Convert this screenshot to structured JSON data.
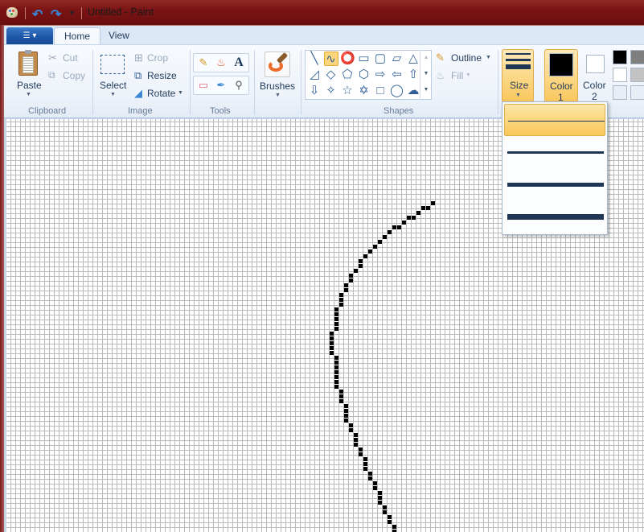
{
  "window": {
    "title": "Untitled - Paint",
    "qat": {
      "undo_icon": "undo-icon",
      "redo_icon": "redo-icon",
      "customize_icon": "chevron-down-icon"
    }
  },
  "tabs": {
    "file_menu_icon": "menu-icon",
    "items": [
      {
        "label": "Home",
        "active": true
      },
      {
        "label": "View",
        "active": false
      }
    ]
  },
  "ribbon": {
    "clipboard": {
      "group_label": "Clipboard",
      "paste": "Paste",
      "cut": "Cut",
      "copy": "Copy"
    },
    "image": {
      "group_label": "Image",
      "select": "Select",
      "crop": "Crop",
      "resize": "Resize",
      "rotate": "Rotate"
    },
    "tools": {
      "group_label": "Tools",
      "items": [
        "pencil",
        "fill",
        "text",
        "eraser",
        "color-picker",
        "magnifier"
      ],
      "text_glyph": "A"
    },
    "brushes": {
      "label": "Brushes"
    },
    "shapes": {
      "group_label": "Shapes",
      "gallery": [
        [
          "line",
          "curve",
          "oval",
          "rectangle",
          "rounded-rectangle",
          "polygon",
          "triangle"
        ],
        [
          "right-triangle",
          "diamond",
          "pentagon",
          "hexagon",
          "right-arrow",
          "left-arrow",
          "up-arrow"
        ],
        [
          "down-arrow",
          "four-point-star",
          "five-point-star",
          "six-point-star",
          "rounded-callout",
          "oval-callout",
          "cloud-callout"
        ]
      ],
      "selected": "curve",
      "outline": "Outline",
      "fill": "Fill"
    },
    "size": {
      "label": "Size"
    },
    "color1": {
      "label": "Color",
      "number": "1",
      "value": "#000000"
    },
    "color2": {
      "label": "Color",
      "number": "2",
      "value": "#ffffff"
    },
    "palette": [
      "#000000",
      "#7f7f7f",
      "#ffffff",
      "#c3c3c3",
      "#e8eef6",
      "#e8eef6"
    ]
  },
  "size_menu": {
    "options": [
      {
        "weight": 1,
        "selected": true
      },
      {
        "weight": 3,
        "selected": false
      },
      {
        "weight": 5,
        "selected": false
      },
      {
        "weight": 8,
        "selected": false
      }
    ],
    "line_color": "#1f3656"
  },
  "canvas": {
    "zoom_grid": true,
    "stroke_color": "#000000",
    "stroke_cells": [
      [
        536,
        250
      ],
      [
        530,
        256
      ],
      [
        524,
        256
      ],
      [
        518,
        262
      ],
      [
        512,
        268
      ],
      [
        506,
        268
      ],
      [
        500,
        274
      ],
      [
        494,
        280
      ],
      [
        488,
        280
      ],
      [
        482,
        286
      ],
      [
        476,
        292
      ],
      [
        470,
        298
      ],
      [
        464,
        304
      ],
      [
        458,
        310
      ],
      [
        452,
        316
      ],
      [
        446,
        322
      ],
      [
        446,
        328
      ],
      [
        440,
        334
      ],
      [
        434,
        340
      ],
      [
        434,
        346
      ],
      [
        428,
        352
      ],
      [
        428,
        358
      ],
      [
        422,
        364
      ],
      [
        422,
        370
      ],
      [
        422,
        376
      ],
      [
        416,
        382
      ],
      [
        416,
        388
      ],
      [
        416,
        394
      ],
      [
        416,
        400
      ],
      [
        416,
        406
      ],
      [
        410,
        412
      ],
      [
        410,
        418
      ],
      [
        410,
        424
      ],
      [
        410,
        430
      ],
      [
        410,
        436
      ],
      [
        416,
        442
      ],
      [
        416,
        448
      ],
      [
        416,
        454
      ],
      [
        416,
        460
      ],
      [
        416,
        466
      ],
      [
        416,
        472
      ],
      [
        416,
        478
      ],
      [
        422,
        484
      ],
      [
        422,
        490
      ],
      [
        422,
        496
      ],
      [
        428,
        502
      ],
      [
        428,
        508
      ],
      [
        428,
        514
      ],
      [
        428,
        520
      ],
      [
        434,
        526
      ],
      [
        434,
        532
      ],
      [
        440,
        538
      ],
      [
        440,
        544
      ],
      [
        440,
        550
      ],
      [
        446,
        556
      ],
      [
        446,
        562
      ],
      [
        452,
        568
      ],
      [
        452,
        574
      ],
      [
        452,
        580
      ],
      [
        458,
        586
      ],
      [
        458,
        592
      ],
      [
        464,
        598
      ],
      [
        464,
        604
      ],
      [
        470,
        610
      ],
      [
        470,
        616
      ],
      [
        470,
        622
      ],
      [
        476,
        628
      ],
      [
        476,
        634
      ],
      [
        482,
        640
      ],
      [
        482,
        646
      ],
      [
        488,
        652
      ],
      [
        488,
        658
      ]
    ]
  }
}
